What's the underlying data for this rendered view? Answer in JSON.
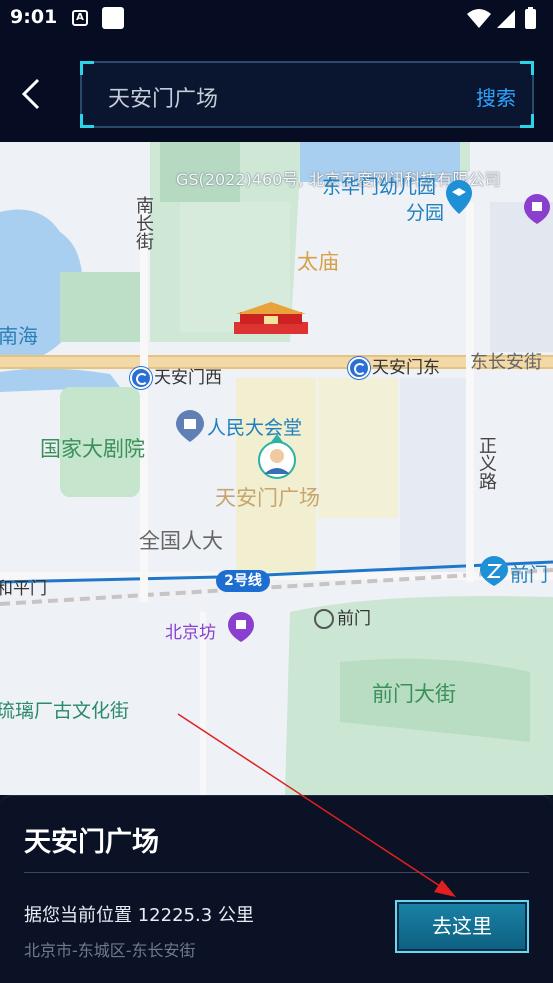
{
  "status_bar": {
    "time": "9:01",
    "a_icon": "A"
  },
  "header": {
    "back_icon": "chevron-left-icon",
    "search_value": "天安门广场",
    "search_button": "搜索"
  },
  "map": {
    "watermark": "GS(2022)460号, 北京百度网讯科技有限公司",
    "labels": {
      "nan_chang_jie": "南长街",
      "tai_miao": "太庙",
      "nan_hai": "南海",
      "kindergarten_1": "东华门幼儿园",
      "kindergarten_2": "分园",
      "tiananmen_west": "天安门西",
      "tiananmen_east": "天安门东",
      "dong_chang_an": "东长安街",
      "great_hall": "人民大会堂",
      "national_theatre": "国家大剧院",
      "zhengyi_road": "正义路",
      "square": "天安门广场",
      "npc": "全国人大",
      "hepingmen": "和平门",
      "line2": "2号线",
      "qianmen_station": "前门",
      "qianmen_east": "前门",
      "beijingfang": "北京坊",
      "qianmen_street": "前门大街",
      "liulichang": "琉璃厂古文化街"
    }
  },
  "panel": {
    "title": "天安门广场",
    "distance": "据您当前位置 12225.3 公里",
    "address": "北京市-东城区-东长安街",
    "go_button": "去这里"
  },
  "colors": {
    "header_bg": "#060d22",
    "accent_cyan": "#2cd4e8",
    "search_blue": "#2fa4ff",
    "annotation_red": "#e02020"
  }
}
